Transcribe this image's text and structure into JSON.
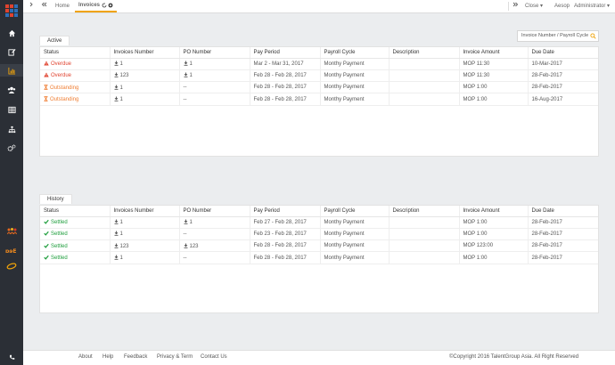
{
  "colors": {
    "sidebar": "#2b2f36",
    "accent": "#f0a30a",
    "overdue": "#e0432f",
    "outstanding": "#ef7d32",
    "settled": "#1e9e3c"
  },
  "topbar": {
    "home": "Home",
    "active_tab": "Invoices",
    "close": "Close",
    "user_short": "Aesop",
    "user_role": "Administrator"
  },
  "search": {
    "placeholder": "Invoice Number / Payroll Cycle"
  },
  "columns": [
    "Status",
    "Invoices Number",
    "PO Number",
    "Pay Period",
    "Payroll Cycle",
    "Description",
    "Invoice Amount",
    "Due Date"
  ],
  "active": {
    "label": "Active",
    "rows": [
      {
        "status": "Overdue",
        "invoice": "1",
        "po": "1",
        "period": "Mar 2 - Mar 31, 2017",
        "cycle": "Monthy Payment",
        "desc": "",
        "amount": "MOP 11:30",
        "due": "10-Mar-2017"
      },
      {
        "status": "Overdue",
        "invoice": "123",
        "po": "1",
        "period": "Feb 28 - Feb 28, 2017",
        "cycle": "Monthy Payment",
        "desc": "",
        "amount": "MOP 11:30",
        "due": "28-Feb-2017"
      },
      {
        "status": "Outstanding",
        "invoice": "1",
        "po": "--",
        "period": "Feb 28 - Feb 28, 2017",
        "cycle": "Monthy Payment",
        "desc": "",
        "amount": "MOP 1:00",
        "due": "28-Feb-2017"
      },
      {
        "status": "Outstanding",
        "invoice": "1",
        "po": "--",
        "period": "Feb 28 - Feb 28, 2017",
        "cycle": "Monthy Payment",
        "desc": "",
        "amount": "MOP 1:00",
        "due": "16-Aug-2017"
      }
    ]
  },
  "history": {
    "label": "History",
    "rows": [
      {
        "status": "Settled",
        "invoice": "1",
        "po": "1",
        "period": "Feb 27 - Feb 28, 2017",
        "cycle": "Monthy Payment",
        "desc": "",
        "amount": "MOP 1:00",
        "due": "28-Feb-2017"
      },
      {
        "status": "Settled",
        "invoice": "1",
        "po": "--",
        "period": "Feb 23 - Feb 28, 2017",
        "cycle": "Monthy Payment",
        "desc": "",
        "amount": "MOP 1:00",
        "due": "28-Feb-2017"
      },
      {
        "status": "Settled",
        "invoice": "123",
        "po": "123",
        "period": "Feb 28 - Feb 28, 2017",
        "cycle": "Monthy Payment",
        "desc": "",
        "amount": "MOP 123:00",
        "due": "28-Feb-2017"
      },
      {
        "status": "Settled",
        "invoice": "1",
        "po": "--",
        "period": "Feb 28 - Feb 28, 2017",
        "cycle": "Monthy Payment",
        "desc": "",
        "amount": "MOP 1:00",
        "due": "28-Feb-2017"
      }
    ]
  },
  "footer": {
    "links": [
      "About",
      "Help",
      "Feedback",
      "Privacy & Term",
      "Contact Us"
    ],
    "copyright": "©Copyright 2016 TalentGroup Asia. All Right Reserved"
  }
}
